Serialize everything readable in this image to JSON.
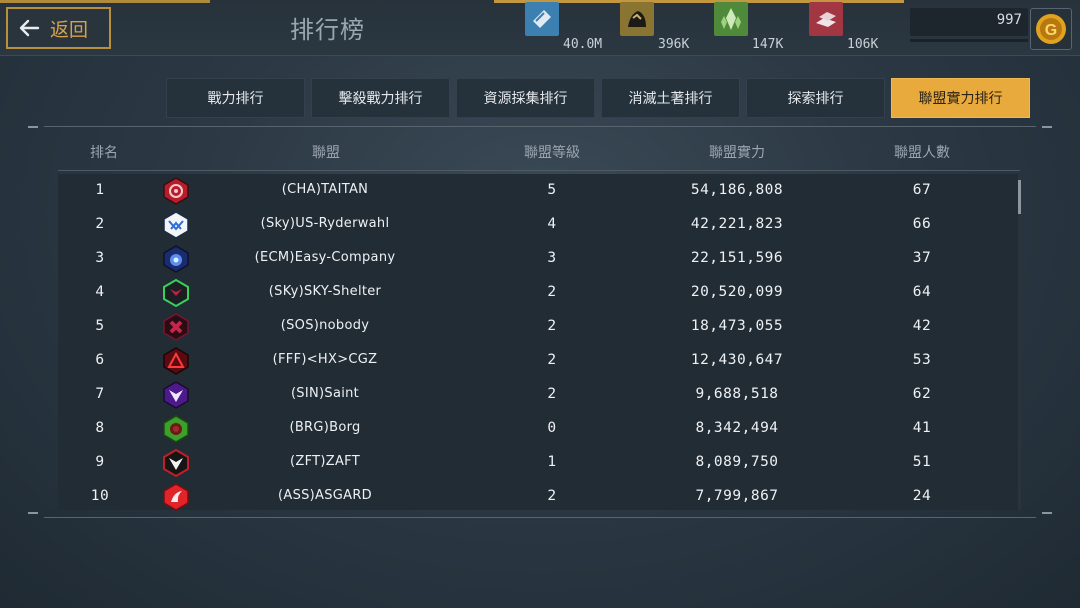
{
  "header": {
    "back_label": "返回",
    "title": "排行榜"
  },
  "resources": [
    {
      "icon": "crystal-vial-icon",
      "value": "40.0M",
      "color": "#3c7fb1"
    },
    {
      "icon": "ore-icon",
      "value": "396K",
      "color": "#8a7431"
    },
    {
      "icon": "green-crystal-icon",
      "value": "147K",
      "color": "#4f8a3a"
    },
    {
      "icon": "metal-ingot-icon",
      "value": "106K",
      "color": "#a23642"
    }
  ],
  "gold": {
    "value": "997",
    "icon": "gold-coin-icon"
  },
  "tabs": [
    {
      "label": "戰力排行",
      "active": false
    },
    {
      "label": "擊殺戰力排行",
      "active": false
    },
    {
      "label": "資源採集排行",
      "active": false
    },
    {
      "label": "消滅土著排行",
      "active": false
    },
    {
      "label": "探索排行",
      "active": false
    },
    {
      "label": "聯盟實力排行",
      "active": true
    }
  ],
  "columns": {
    "rank": "排名",
    "alliance": "聯盟",
    "level": "聯盟等級",
    "power": "聯盟實力",
    "members": "聯盟人數"
  },
  "rows": [
    {
      "rank": "1",
      "name": "(CHA)TAITAN",
      "level": "5",
      "power": "54,186,808",
      "members": "67",
      "emblem": "red-crest-icon"
    },
    {
      "rank": "2",
      "name": "(Sky)US-Ryderwahl",
      "level": "4",
      "power": "42,221,823",
      "members": "66",
      "emblem": "white-blue-crest-icon"
    },
    {
      "rank": "3",
      "name": "(ECM)Easy-Company",
      "level": "3",
      "power": "22,151,596",
      "members": "37",
      "emblem": "blue-crest-icon"
    },
    {
      "rank": "4",
      "name": "(SKy)SKY-Shelter",
      "level": "2",
      "power": "20,520,099",
      "members": "64",
      "emblem": "green-red-crest-icon"
    },
    {
      "rank": "5",
      "name": "(SOS)nobody",
      "level": "2",
      "power": "18,473,055",
      "members": "42",
      "emblem": "dark-red-crest-icon"
    },
    {
      "rank": "6",
      "name": "(FFF)<HX>CGZ",
      "level": "2",
      "power": "12,430,647",
      "members": "53",
      "emblem": "red-triangle-crest-icon"
    },
    {
      "rank": "7",
      "name": "(SIN)Saint",
      "level": "2",
      "power": "9,688,518",
      "members": "62",
      "emblem": "purple-crest-icon"
    },
    {
      "rank": "8",
      "name": "(BRG)Borg",
      "level": "0",
      "power": "8,342,494",
      "members": "41",
      "emblem": "green-crest-icon"
    },
    {
      "rank": "9",
      "name": "(ZFT)ZAFT",
      "level": "1",
      "power": "8,089,750",
      "members": "51",
      "emblem": "black-red-crest-icon"
    },
    {
      "rank": "10",
      "name": "(ASS)ASGARD",
      "level": "2",
      "power": "7,799,867",
      "members": "24",
      "emblem": "red-white-crest-icon"
    }
  ]
}
